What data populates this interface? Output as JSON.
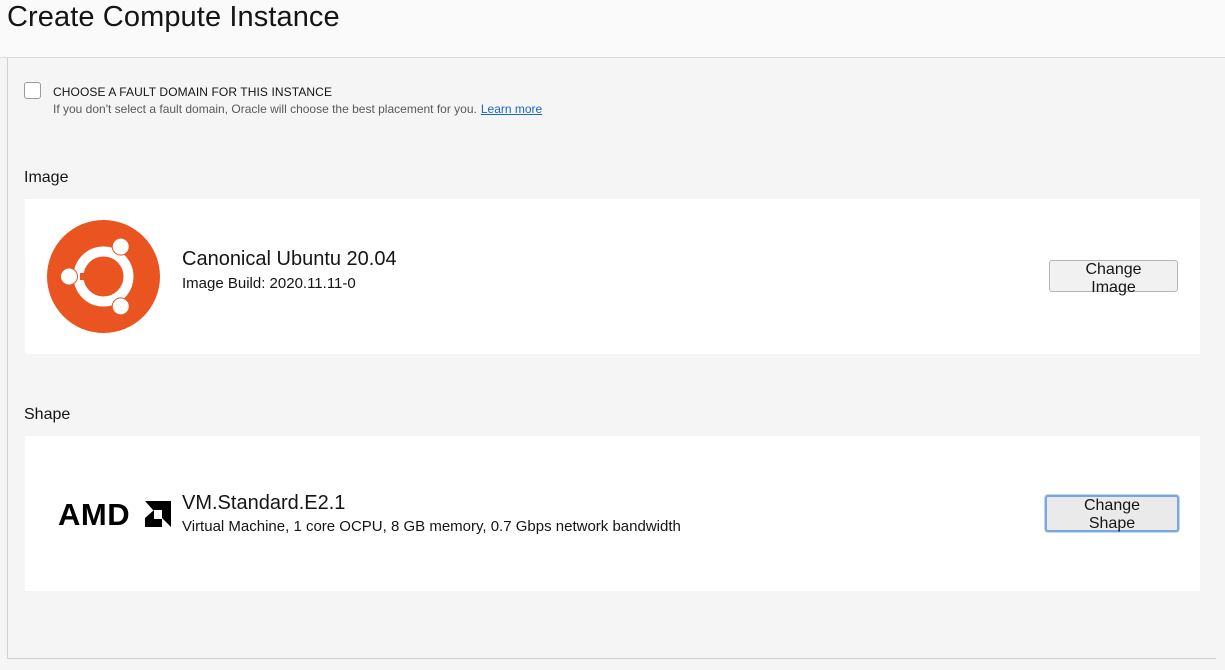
{
  "header": {
    "title": "Create Compute Instance"
  },
  "fault_domain": {
    "label": "CHOOSE A FAULT DOMAIN FOR THIS INSTANCE",
    "help": "If you don't select a fault domain, Oracle will choose the best placement for you.",
    "link": "Learn more",
    "checked": false
  },
  "image": {
    "section_label": "Image",
    "name": "Canonical Ubuntu 20.04",
    "build": "Image Build: 2020.11.11-0",
    "button": "Change Image",
    "logo": "ubuntu-logo",
    "logo_color": "#e95420"
  },
  "shape": {
    "section_label": "Shape",
    "name": "VM.Standard.E2.1",
    "description": "Virtual Machine, 1 core OCPU, 8 GB memory, 0.7 Gbps network bandwidth",
    "button": "Change Shape",
    "logo": "amd-logo",
    "logo_text": "AMD"
  }
}
